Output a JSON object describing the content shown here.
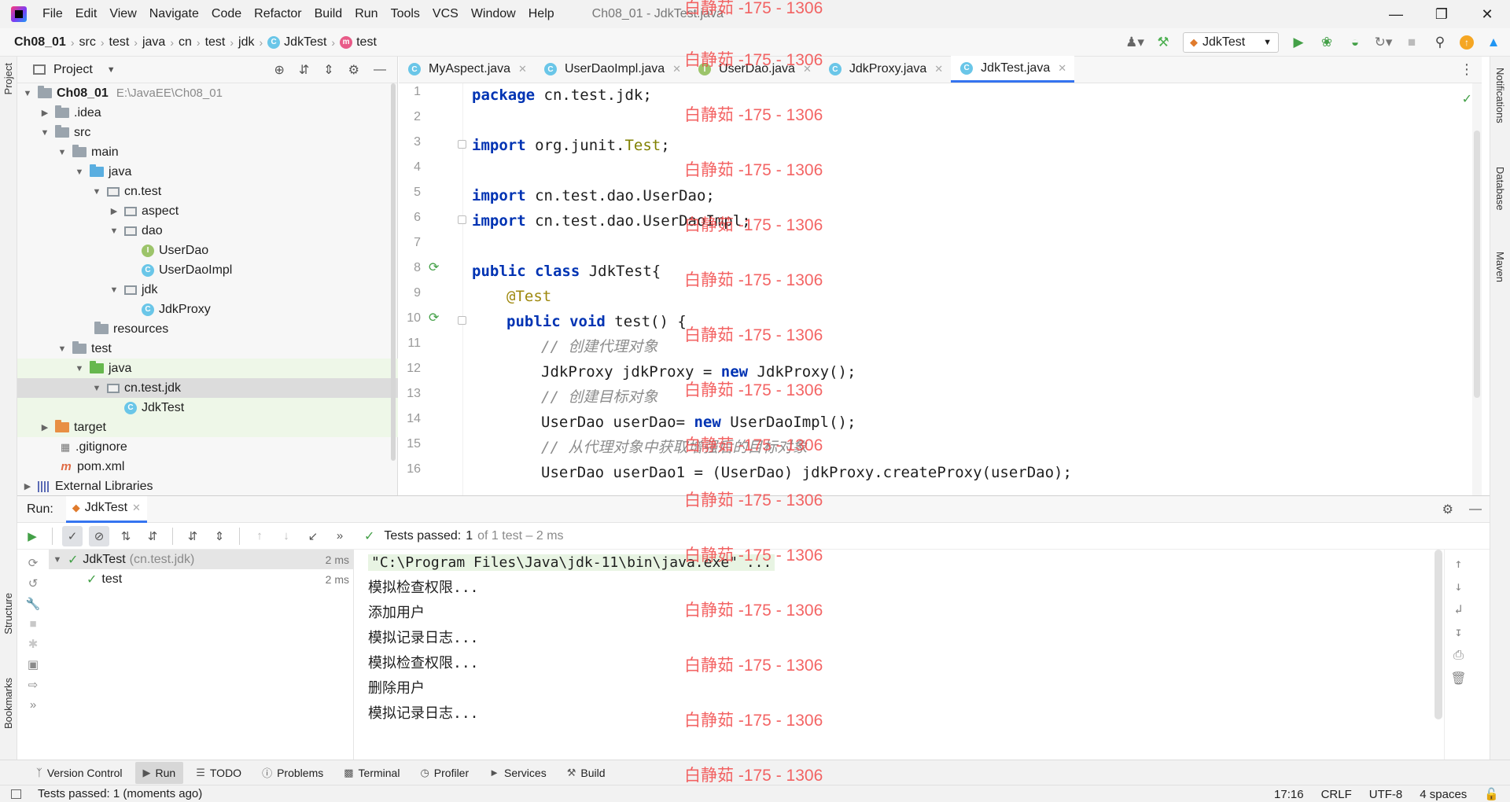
{
  "menubar": {
    "items": [
      "File",
      "Edit",
      "View",
      "Navigate",
      "Code",
      "Refactor",
      "Build",
      "Run",
      "Tools",
      "VCS",
      "Window",
      "Help"
    ],
    "window_title": "Ch08_01 - JdkTest.java"
  },
  "breadcrumb": [
    "Ch08_01",
    "src",
    "test",
    "java",
    "cn",
    "test",
    "jdk",
    "JdkTest",
    "test"
  ],
  "run_config": "JdkTest",
  "project": {
    "title": "Project",
    "tree": [
      {
        "label": "Ch08_01",
        "hint": "E:\\JavaEE\\Ch08_01"
      },
      {
        "label": ".idea"
      },
      {
        "label": "src"
      },
      {
        "label": "main"
      },
      {
        "label": "java"
      },
      {
        "label": "cn.test"
      },
      {
        "label": "aspect"
      },
      {
        "label": "dao"
      },
      {
        "label": "UserDao"
      },
      {
        "label": "UserDaoImpl"
      },
      {
        "label": "jdk"
      },
      {
        "label": "JdkProxy"
      },
      {
        "label": "resources"
      },
      {
        "label": "test"
      },
      {
        "label": "java"
      },
      {
        "label": "cn.test.jdk"
      },
      {
        "label": "JdkTest"
      },
      {
        "label": "target"
      },
      {
        "label": ".gitignore"
      },
      {
        "label": "pom.xml"
      },
      {
        "label": "External Libraries"
      }
    ]
  },
  "editor": {
    "tabs": [
      "MyAspect.java",
      "UserDaoImpl.java",
      "UserDao.java",
      "JdkProxy.java",
      "JdkTest.java"
    ],
    "active_tab": "JdkTest.java",
    "line_numbers": [
      "1",
      "2",
      "3",
      "4",
      "5",
      "6",
      "7",
      "8",
      "9",
      "10",
      "11",
      "12",
      "13",
      "14",
      "15",
      "16"
    ]
  },
  "code": {
    "l1_kw": "package",
    "l1_rest": " cn.test.jdk;",
    "l3_kw": "import",
    "l3_a": " org.junit.",
    "l3_cls": "Test",
    "l3_b": ";",
    "l5_kw": "import",
    "l5_rest": " cn.test.dao.UserDao;",
    "l6_kw": "import",
    "l6_rest": " cn.test.dao.UserDaoImpl;",
    "l8_kw": "public class",
    "l8_rest": " JdkTest{",
    "l9_ann": "@Test",
    "l10_kw": "public void",
    "l10_rest": " test() {",
    "l11_cmt": "// 创建代理对象",
    "l12_a": "JdkProxy jdkProxy = ",
    "l12_kw": "new",
    "l12_b": " JdkProxy();",
    "l13_cmt": "// 创建目标对象",
    "l14_a": "UserDao userDao= ",
    "l14_kw": "new",
    "l14_b": " UserDaoImpl();",
    "l15_cmt": "// 从代理对象中获取增强后的目标对象",
    "l16": "UserDao userDao1 = (UserDao) jdkProxy.createProxy(userDao);"
  },
  "run": {
    "label": "Run:",
    "tab": "JdkTest",
    "tests_passed_label": "Tests passed:",
    "tests_passed_count": "1",
    "tests_passed_rest": "of 1 test – 2 ms",
    "tree": [
      {
        "name": "JdkTest",
        "pkg": "(cn.test.jdk)",
        "time": "2 ms"
      },
      {
        "name": "test",
        "time": "2 ms"
      }
    ],
    "console": [
      "\"C:\\Program Files\\Java\\jdk-11\\bin\\java.exe\" ...",
      "模拟检查权限...",
      "添加用户",
      "模拟记录日志...",
      "模拟检查权限...",
      "删除用户",
      "模拟记录日志..."
    ]
  },
  "sidebars": {
    "left": [
      "Project",
      "Structure",
      "Bookmarks"
    ],
    "right": [
      "Notifications",
      "Database",
      "Maven"
    ]
  },
  "bottom_tools": [
    "Version Control",
    "Run",
    "TODO",
    "Problems",
    "Terminal",
    "Profiler",
    "Services",
    "Build"
  ],
  "status": {
    "message": "Tests passed: 1 (moments ago)",
    "position": "17:16",
    "line_sep": "CRLF",
    "encoding": "UTF-8",
    "indent": "4 spaces"
  },
  "watermark": "白静茹 -175 - 1306",
  "colors": {
    "accent": "#3574f0",
    "run_green": "#43a047",
    "watermark": "#f24a4a",
    "keyword": "#0033b3"
  }
}
